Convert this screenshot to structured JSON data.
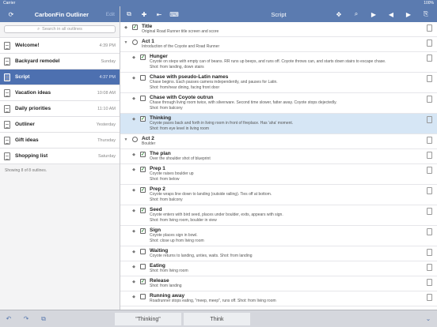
{
  "status": {
    "left": "Carrier",
    "time": "",
    "right": "100%"
  },
  "sidebar": {
    "title": "CarbonFin Outliner",
    "edit": "Edit",
    "search_placeholder": "Search in all outlines",
    "footer": "Showing 8 of 8 outlines.",
    "items": [
      {
        "name": "Welcome!",
        "date": "4:39 PM"
      },
      {
        "name": "Backyard remodel",
        "date": "Sunday"
      },
      {
        "name": "Script",
        "date": "4:37 PM"
      },
      {
        "name": "Vacation ideas",
        "date": "10:08 AM"
      },
      {
        "name": "Daily priorities",
        "date": "11:10 AM"
      },
      {
        "name": "Outliner",
        "date": "Yesterday"
      },
      {
        "name": "Gift ideas",
        "date": "Thursday"
      },
      {
        "name": "Shopping list",
        "date": "Saturday"
      }
    ]
  },
  "header": {
    "title": "Script",
    "icons": [
      "copy-icon",
      "indent-add-icon",
      "outdent-icon",
      "keyboard-icon",
      "move-icon",
      "search-icon",
      "play-icon",
      "prev-icon",
      "next-icon",
      "share-icon"
    ]
  },
  "rows": [
    {
      "arrow": "◆",
      "check": "checked",
      "title": "Title",
      "sub": [
        "Original Road Runner title screen and score"
      ],
      "indent": 0
    },
    {
      "arrow": "▼",
      "check": "clock",
      "title": "Act 1",
      "sub": [
        "Introduction of the Coyote and Road Runner"
      ],
      "indent": 0
    },
    {
      "arrow": "◆",
      "check": "checked",
      "title": "Hunger",
      "sub": [
        "Coyote on steps with empty can of beans. RR runs up beeps, and runs off. Coyote throws can, and starts down stairs to escape chase.",
        "Shot: from landing, down stairs"
      ],
      "indent": 1
    },
    {
      "arrow": "◆",
      "check": "empty",
      "title": "Chase with pseudo-Latin names",
      "sub": [
        "Chase begins. Each passes camera independently, and pauses for Latin.",
        "Shot: from/near dining, facing front door"
      ],
      "indent": 1
    },
    {
      "arrow": "◆",
      "check": "empty",
      "title": "Chase with Coyote outrun",
      "sub": [
        "Chase through living room twice, with silverware. Second time slower, fatter away. Coyote stops dejectedly.",
        "Shot: from balcony"
      ],
      "indent": 1
    },
    {
      "arrow": "◆",
      "check": "checked",
      "title": "Thinking",
      "sub": [
        "Coyote paces back and forth in living room in front of fireplace. Has 'aha' moment.",
        "Shot: from eye level in living room"
      ],
      "indent": 1,
      "selected": true
    },
    {
      "arrow": "▼",
      "check": "clock",
      "title": "Act 2",
      "sub": [
        "Boulder"
      ],
      "indent": 0
    },
    {
      "arrow": "◆",
      "check": "checked",
      "title": "The plan",
      "sub": [
        "Over the shoulder shot of blueprint"
      ],
      "indent": 1
    },
    {
      "arrow": "◆",
      "check": "checked",
      "title": "Prep 1",
      "sub": [
        "Coyote raises boulder up",
        "Shot: from below"
      ],
      "indent": 1
    },
    {
      "arrow": "◆",
      "check": "checked",
      "title": "Prep 2",
      "sub": [
        "Coyote wraps line down to landing (outside railing). Ties off at bottom.",
        "Shot: from balcony"
      ],
      "indent": 1
    },
    {
      "arrow": "◆",
      "check": "checked",
      "title": "Seed",
      "sub": [
        "Coyote enters with bird seed, places under boulder, exits, appears with sign.",
        "Shot: from living room, boulder in view"
      ],
      "indent": 1
    },
    {
      "arrow": "◆",
      "check": "checked",
      "title": "Sign",
      "sub": [
        "Coyote places sign in bowl.",
        "Shot: close up from living room"
      ],
      "indent": 1
    },
    {
      "arrow": "◆",
      "check": "empty",
      "title": "Waiting",
      "sub": [
        "Coyote returns to landing, unties, waits. Shot: from landing"
      ],
      "indent": 1
    },
    {
      "arrow": "◆",
      "check": "empty",
      "title": "Eating",
      "sub": [
        "Shot: from living room"
      ],
      "indent": 1
    },
    {
      "arrow": "◆",
      "check": "checked",
      "title": "Release",
      "sub": [
        "Shot: from landing"
      ],
      "indent": 1
    },
    {
      "arrow": "◆",
      "check": "empty",
      "title": "Running away",
      "sub": [
        "Roadrunner stops eating, \"meep, meep\", runs off. Shot: from living room"
      ],
      "indent": 1
    }
  ],
  "bottom": {
    "suggestions": [
      "\"Thinking\"",
      "Think"
    ]
  }
}
